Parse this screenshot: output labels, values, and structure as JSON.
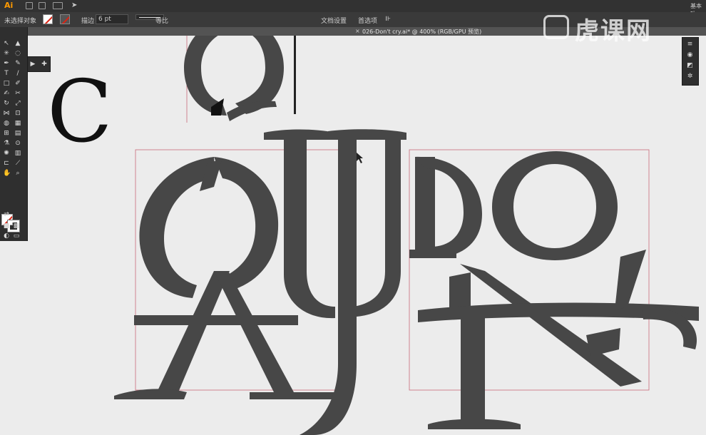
{
  "app": {
    "logo": "Ai"
  },
  "menubar": {
    "right_text": "基本功"
  },
  "controlbar": {
    "selection_label": "未选择对象",
    "stroke_label": "描边",
    "stroke_weight": "6 pt",
    "profile_label": "等比",
    "doc_setup": "文档设置",
    "preferences": "首选项"
  },
  "document": {
    "tab_title": "026-Don't cry.ai* @ 400% (RGB/GPU 预览)",
    "close_glyph": "×"
  },
  "canvas": {
    "preview_letter": "C"
  },
  "watermark": {
    "text": "虎课网"
  },
  "colors": {
    "glyph": "#474747",
    "artboard_guide": "#c86a7a",
    "ui_dark": "#323232",
    "accent": "#ff9a00"
  },
  "tools": {
    "icons": [
      "selection-icon",
      "direct-selection-icon",
      "magic-wand-icon",
      "lasso-icon",
      "pen-icon",
      "curvature-icon",
      "type-icon",
      "line-icon",
      "rectangle-icon",
      "paintbrush-icon",
      "shaper-icon",
      "eraser-icon",
      "rotate-icon",
      "scale-icon",
      "width-icon",
      "free-transform-icon",
      "shape-builder-icon",
      "perspective-icon",
      "mesh-icon",
      "gradient-icon",
      "eyedropper-icon",
      "blend-icon",
      "symbol-sprayer-icon",
      "graph-icon",
      "artboard-icon",
      "slice-icon",
      "hand-icon",
      "zoom-icon"
    ]
  }
}
